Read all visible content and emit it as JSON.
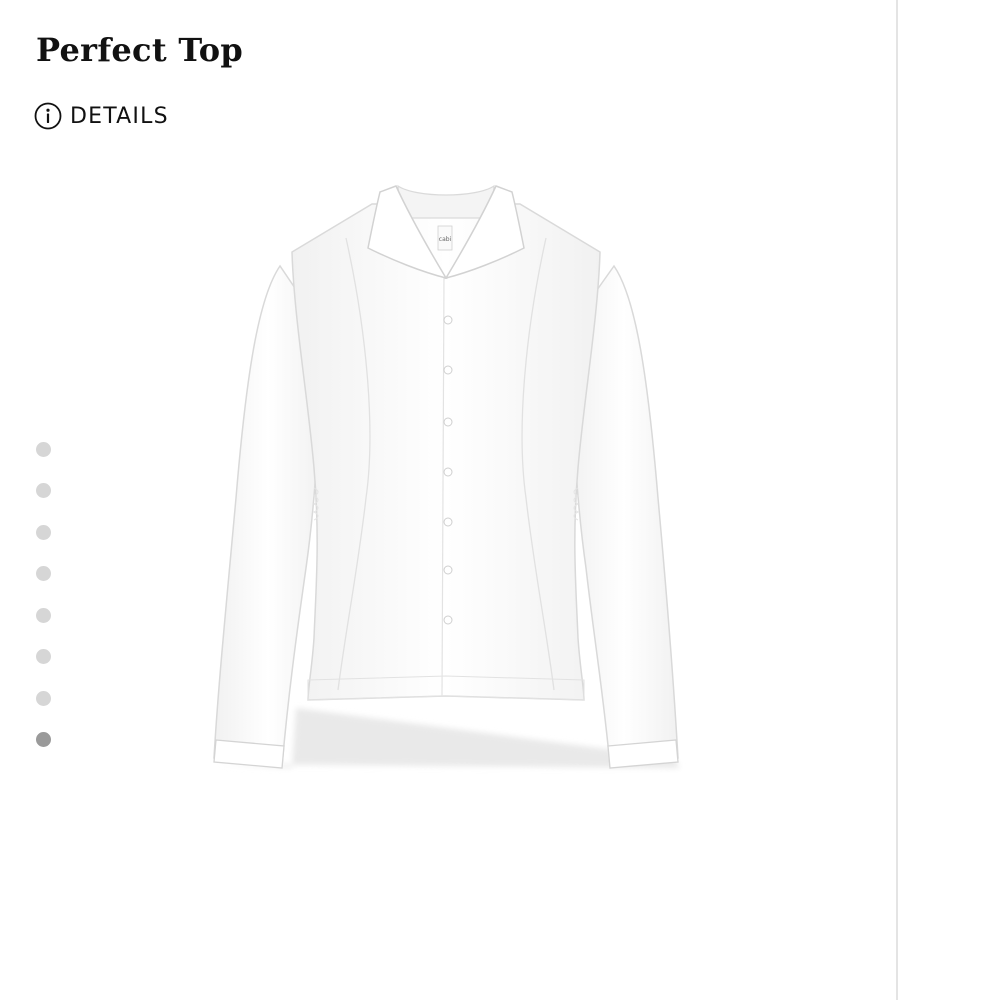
{
  "product": {
    "title": "Perfect Top",
    "image_label": "cabi"
  },
  "details": {
    "label": "DETAILS",
    "icon": "info-icon"
  },
  "carousel": {
    "total": 8,
    "active_index": 7
  },
  "colors": {
    "text": "#111111",
    "dot_inactive": "#d6d6d6",
    "dot_active": "#9a9a9a",
    "divider": "#e4e4e4",
    "shirt": "#ffffff",
    "shirt_outline": "#d9d9d9"
  }
}
